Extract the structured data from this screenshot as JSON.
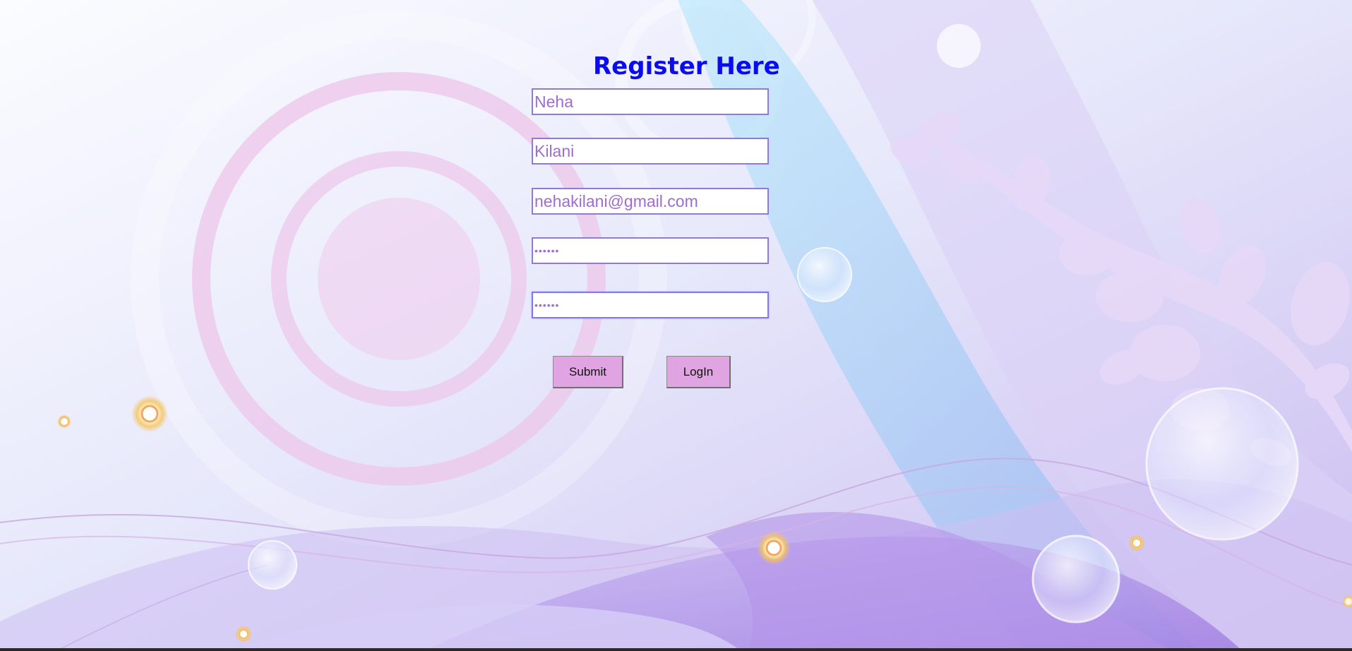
{
  "page": {
    "title": "Register Here"
  },
  "fields": {
    "first_name": "Neha",
    "last_name": "Kilani",
    "email": "nehakilani@gmail.com",
    "password": "••••••",
    "confirm_password": "••••••"
  },
  "buttons": {
    "submit_label": "Submit",
    "login_label": "LogIn"
  },
  "colors": {
    "title": "#0b0bf0",
    "field_border": "#8f7ad8",
    "field_text": "#a06ccf",
    "button_bg": "#e0a4e2"
  }
}
